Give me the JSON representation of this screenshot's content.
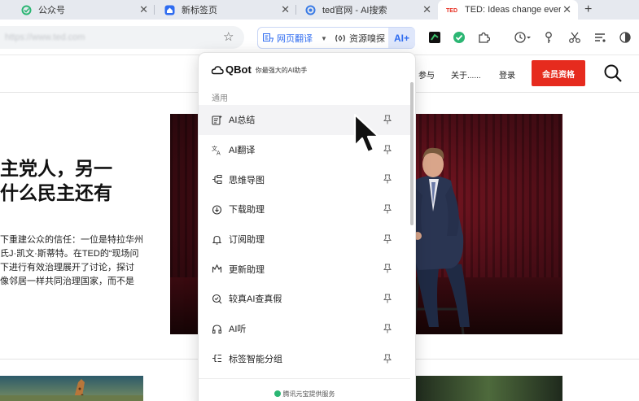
{
  "tabs": [
    {
      "title": "公众号",
      "icon": "wechat-green-icon",
      "active": false
    },
    {
      "title": "新标签页",
      "icon": "qq-browser-house-icon",
      "active": false
    },
    {
      "title": "ted官网 - AI搜索",
      "icon": "ai-search-icon",
      "active": false
    },
    {
      "title": "TED: Ideas change ever",
      "icon": "ted-favicon",
      "active": true
    }
  ],
  "toolbar": {
    "url_text": "https://www.ted.com",
    "translate_label": "网页翻译",
    "sniff_label": "资源嗅探",
    "ai_label": "AI+"
  },
  "page": {
    "nav": [
      "参与",
      "关于......",
      "登录"
    ],
    "member_button": "会员资格",
    "headline_lines": [
      "主党人，另一",
      "什么民主还有"
    ],
    "body_lines": [
      "下重建公众的信任：一位是特拉华州",
      "氏J·凯文·斯蒂特。在TED的“现场问",
      "下进行有效治理展开了讨论，探讨",
      "像邻居一样共同治理国家，而不是"
    ]
  },
  "popup": {
    "brand": "QBot",
    "tagline": "你最强大的AI助手",
    "section": "通用",
    "items": [
      {
        "label": "AI总结",
        "icon": "ai-summary-icon"
      },
      {
        "label": "AI翻译",
        "icon": "ai-translate-icon"
      },
      {
        "label": "思维导图",
        "icon": "mind-map-icon"
      },
      {
        "label": "下载助理",
        "icon": "download-assistant-icon"
      },
      {
        "label": "订阅助理",
        "icon": "subscribe-bell-icon"
      },
      {
        "label": "更新助理",
        "icon": "update-assistant-icon"
      },
      {
        "label": "较真AI查真假",
        "icon": "fact-check-icon"
      },
      {
        "label": "AI听",
        "icon": "headphones-icon"
      },
      {
        "label": "标签智能分组",
        "icon": "tab-group-icon"
      }
    ],
    "footer": "腾讯元宝提供服务"
  },
  "colors": {
    "accent_blue": "#2f6cf0",
    "ted_red": "#e62b1e",
    "hover_row": "#f3f3f5"
  }
}
